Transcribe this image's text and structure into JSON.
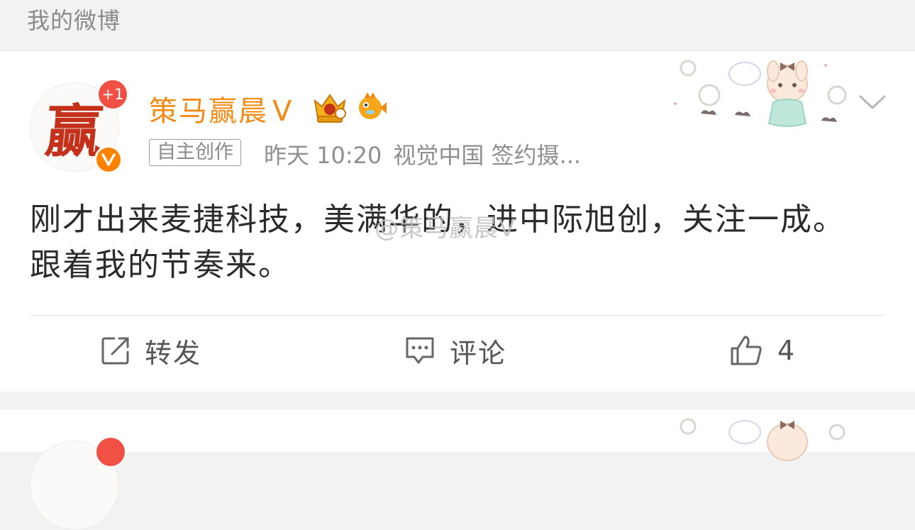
{
  "header": {
    "title": "我的微博"
  },
  "post": {
    "author": {
      "name": "策马赢晨",
      "verified_mark": "V",
      "notification_badge": "+1",
      "avatar_char": "赢"
    },
    "tag": "自主创作",
    "time": "昨天 10:20",
    "source": "视觉中国 签约摄...",
    "text": "刚才出来麦捷科技，美满华的，进中际旭创，关注一成。跟着我的节奏来。",
    "watermark": "@策马赢晨V",
    "actions": {
      "repost_label": "转发",
      "comment_label": "评论",
      "like_count": "4"
    }
  },
  "colors": {
    "username": "#f28b18",
    "badge_red": "#f15045",
    "verified_orange": "#ff8200",
    "text": "#2b2b2b",
    "meta": "#8f8f8f"
  },
  "icons": [
    "crown-badge-icon",
    "fish-badge-icon",
    "chevron-down-icon",
    "repost-icon",
    "comment-icon",
    "like-icon",
    "verified-icon",
    "bunny-sticker-icon"
  ]
}
